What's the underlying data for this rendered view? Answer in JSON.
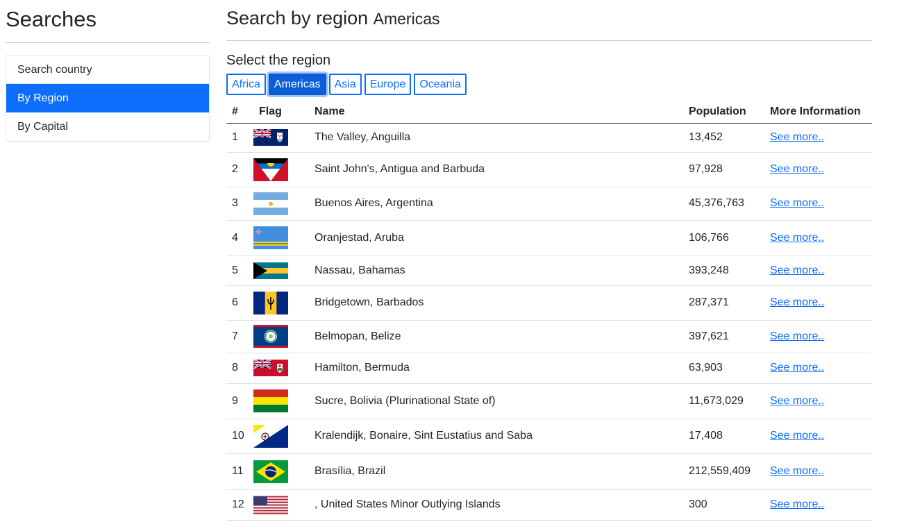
{
  "sidebar": {
    "title": "Searches",
    "items": [
      {
        "label": "Search country",
        "active": false
      },
      {
        "label": "By Region",
        "active": true
      },
      {
        "label": "By Capital",
        "active": false
      }
    ]
  },
  "main": {
    "title": "Search by region",
    "title_region": "Americas",
    "select_label": "Select the region",
    "regions": [
      "Africa",
      "Americas",
      "Asia",
      "Europe",
      "Oceania"
    ],
    "active_region": "Americas"
  },
  "table": {
    "headers": [
      "#",
      "Flag",
      "Name",
      "Population",
      "More Information"
    ],
    "rows": [
      {
        "num": "1",
        "flag": "flag-anguilla",
        "name": "The Valley, Anguilla",
        "population": "13,452",
        "link": "See more.."
      },
      {
        "num": "2",
        "flag": "flag-antigua-barbuda",
        "name": "Saint John's, Antigua and Barbuda",
        "population": "97,928",
        "link": "See more.."
      },
      {
        "num": "3",
        "flag": "flag-argentina",
        "name": "Buenos Aires, Argentina",
        "population": "45,376,763",
        "link": "See more.."
      },
      {
        "num": "4",
        "flag": "flag-aruba",
        "name": "Oranjestad, Aruba",
        "population": "106,766",
        "link": "See more.."
      },
      {
        "num": "5",
        "flag": "flag-bahamas",
        "name": "Nassau, Bahamas",
        "population": "393,248",
        "link": "See more.."
      },
      {
        "num": "6",
        "flag": "flag-barbados",
        "name": "Bridgetown, Barbados",
        "population": "287,371",
        "link": "See more.."
      },
      {
        "num": "7",
        "flag": "flag-belize",
        "name": "Belmopan, Belize",
        "population": "397,621",
        "link": "See more.."
      },
      {
        "num": "8",
        "flag": "flag-bermuda",
        "name": "Hamilton, Bermuda",
        "population": "63,903",
        "link": "See more.."
      },
      {
        "num": "9",
        "flag": "flag-bolivia",
        "name": "Sucre, Bolivia (Plurinational State of)",
        "population": "11,673,029",
        "link": "See more.."
      },
      {
        "num": "10",
        "flag": "flag-bonaire",
        "name": "Kralendijk, Bonaire, Sint Eustatius and Saba",
        "population": "17,408",
        "link": "See more.."
      },
      {
        "num": "11",
        "flag": "flag-brazil",
        "name": "Brasília, Brazil",
        "population": "212,559,409",
        "link": "See more.."
      },
      {
        "num": "12",
        "flag": "flag-us-minor-islands",
        "name": ", United States Minor Outlying Islands",
        "population": "300",
        "link": "See more.."
      }
    ]
  },
  "colors": {
    "primary": "#0d6efd",
    "text": "#212529"
  }
}
